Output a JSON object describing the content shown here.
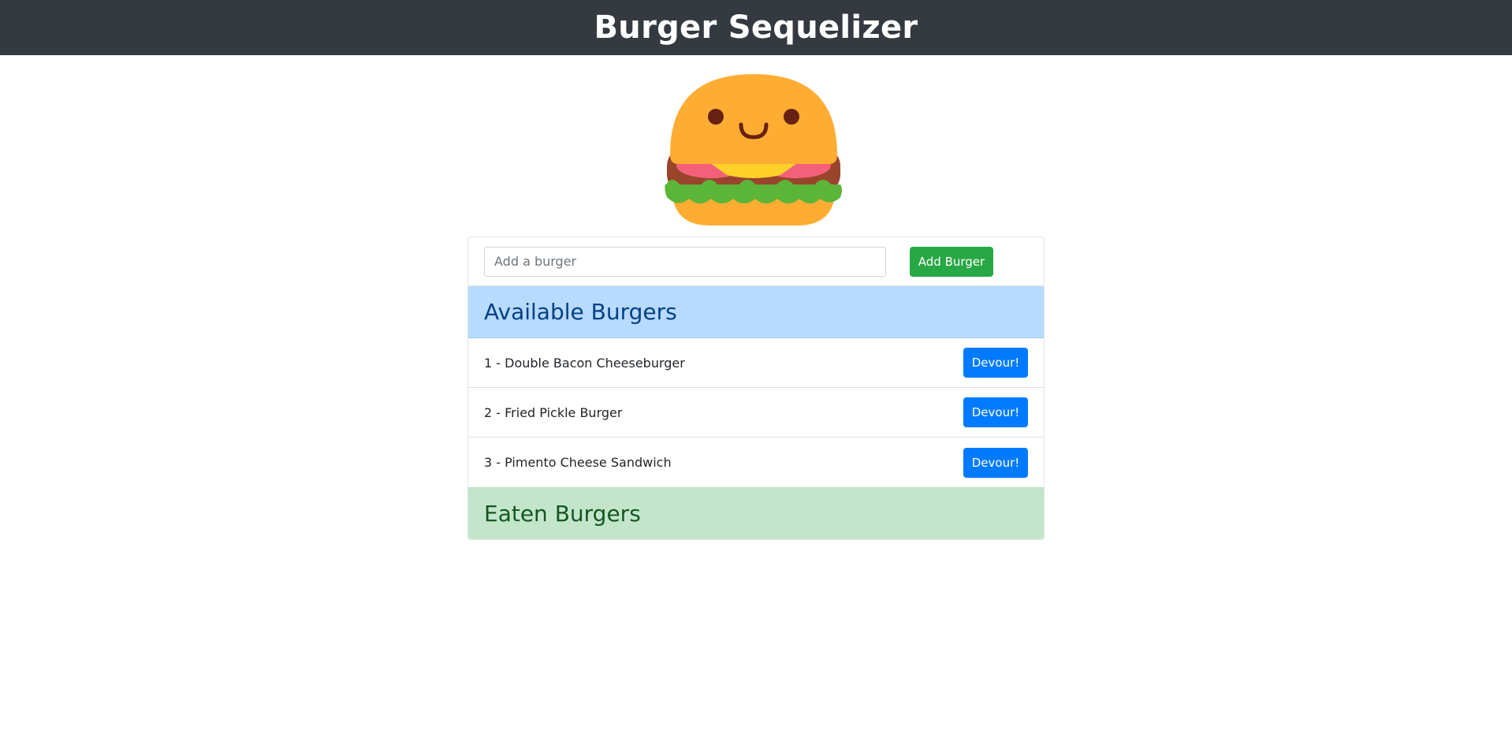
{
  "header": {
    "title": "Burger Sequelizer"
  },
  "logo": {
    "icon": "burger-mascot-icon"
  },
  "form": {
    "placeholder": "Add a burger",
    "value": "",
    "submit_label": "Add Burger"
  },
  "available": {
    "title": "Available Burgers",
    "items": [
      {
        "label": "1 - Double Bacon Cheeseburger",
        "button": "Devour!"
      },
      {
        "label": "2 - Fried Pickle Burger",
        "button": "Devour!"
      },
      {
        "label": "3 - Pimento Cheese Sandwich",
        "button": "Devour!"
      }
    ]
  },
  "eaten": {
    "title": "Eaten Burgers",
    "items": []
  },
  "colors": {
    "navbar": "#343a40",
    "success": "#28a745",
    "primary": "#007bff",
    "available_bg": "#b8daff",
    "eaten_bg": "#c3e6cb"
  }
}
